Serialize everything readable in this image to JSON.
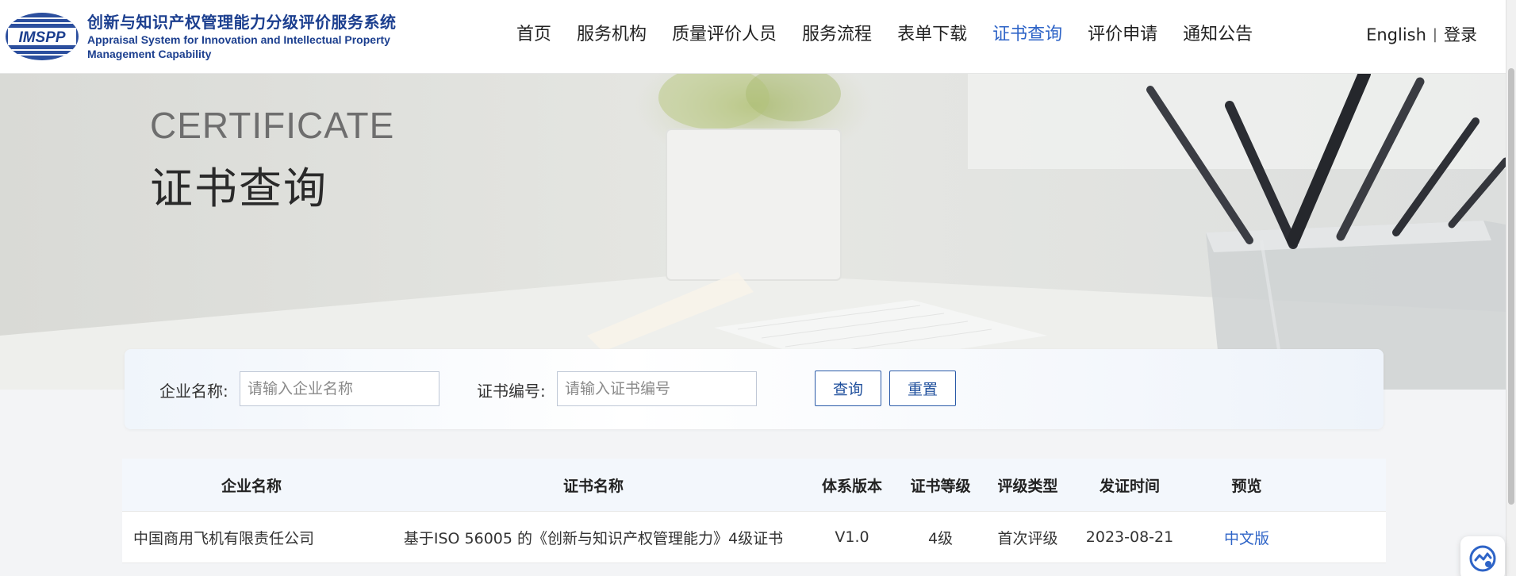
{
  "header": {
    "logo_text": "IMSPP",
    "brand_cn": "创新与知识产权管理能力分级评价服务系统",
    "brand_en_line1": "Appraisal System for Innovation and Intellectual Property",
    "brand_en_line2": "Management Capability",
    "nav": [
      {
        "label": "首页"
      },
      {
        "label": "服务机构"
      },
      {
        "label": "质量评价人员"
      },
      {
        "label": "服务流程"
      },
      {
        "label": "表单下载"
      },
      {
        "label": "证书查询"
      },
      {
        "label": "评价申请"
      },
      {
        "label": "通知公告"
      }
    ],
    "active_nav": "证书查询",
    "lang_label": "English",
    "separator": "|",
    "login_label": "登录"
  },
  "banner": {
    "title_en": "CERTIFICATE",
    "title_cn": "证书查询"
  },
  "search": {
    "company_label": "企业名称:",
    "company_placeholder": "请输入企业名称",
    "cert_label": "证书编号:",
    "cert_placeholder": "请输入证书编号",
    "query_button": "查询",
    "reset_button": "重置"
  },
  "table": {
    "headers": [
      "企业名称",
      "证书名称",
      "体系版本",
      "证书等级",
      "评级类型",
      "发证时间",
      "预览"
    ],
    "rows": [
      {
        "company": "中国商用飞机有限责任公司",
        "certificate": "基于ISO 56005 的《创新与知识产权管理能力》4级证书",
        "version": "V1.0",
        "level": "4级",
        "type": "首次评级",
        "date": "2023-08-21",
        "preview": "中文版"
      }
    ]
  },
  "colors": {
    "brand_blue": "#1c3f8f",
    "accent_blue": "#2e64c7",
    "button_border": "#2a5aa8"
  },
  "icons": {
    "float_widget": "support-chat-icon"
  }
}
